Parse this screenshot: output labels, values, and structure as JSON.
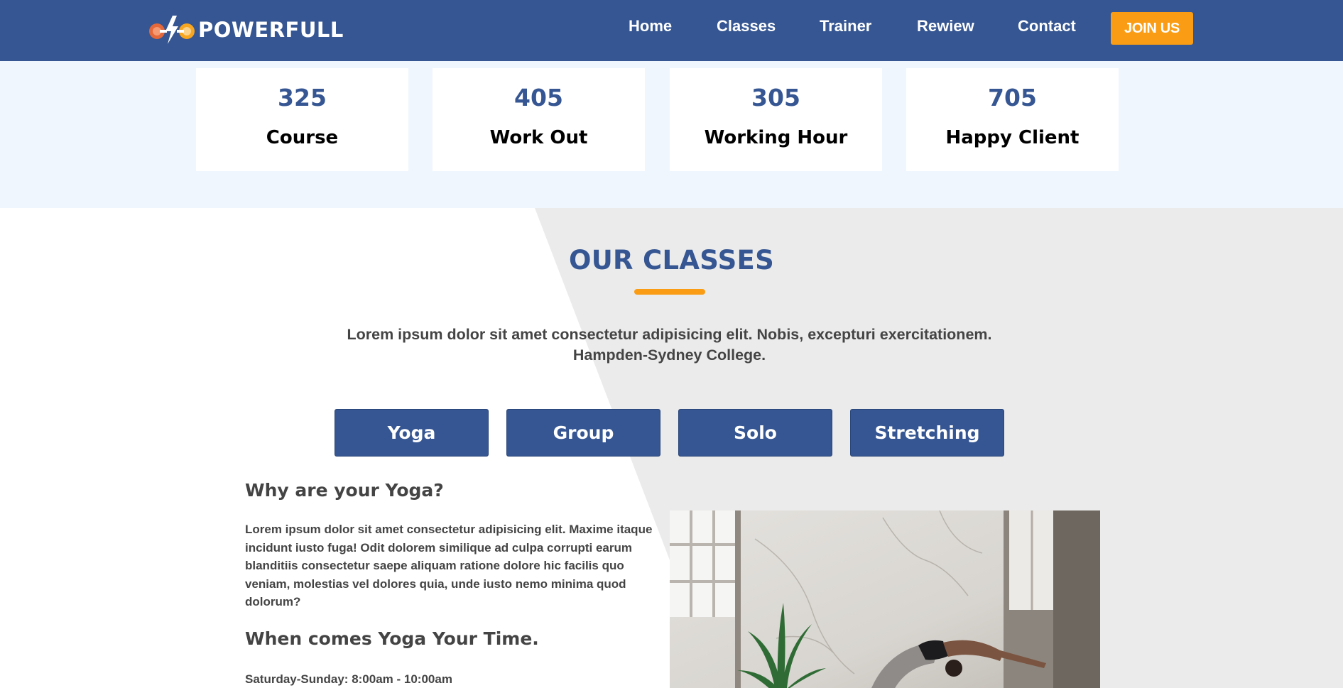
{
  "brand": {
    "name": "POWERFULL",
    "icon": "dumbbell-bolt-icon"
  },
  "nav": {
    "links": [
      "Home",
      "Classes",
      "Trainer",
      "Rewiew",
      "Contact"
    ],
    "cta": "JOIN US"
  },
  "stats": [
    {
      "value": "325",
      "label": "Course"
    },
    {
      "value": "405",
      "label": "Work Out"
    },
    {
      "value": "305",
      "label": "Working Hour"
    },
    {
      "value": "705",
      "label": "Happy Client"
    }
  ],
  "classes": {
    "title": "OUR CLASSES",
    "description_line1": "Lorem ipsum dolor sit amet consectetur adipisicing elit. Nobis, excepturi exercitationem.",
    "description_line2": "Hampden-Sydney College.",
    "tabs": [
      "Yoga",
      "Group",
      "Solo",
      "Stretching"
    ],
    "why_heading": "Why are your Yoga?",
    "why_text": "Lorem ipsum dolor sit amet consectetur adipisicing elit. Maxime itaque incidunt iusto fuga! Odit dolorem similique ad culpa corrupti earum blanditiis consectetur saepe aliquam ratione dolore hic facilis quo veniam, molestias vel dolores quia, unde iusto nemo minima quod dolorum?",
    "when_heading": "When comes Yoga Your Time.",
    "schedule": "Saturday-Sunday: 8:00am - 10:00am",
    "image": "yoga-woman-photo"
  },
  "colors": {
    "primary": "#355692",
    "accent": "#fa9d14",
    "stats_bg": "#eff6fd",
    "section_shade": "#ebebeb",
    "text": "#444444"
  }
}
